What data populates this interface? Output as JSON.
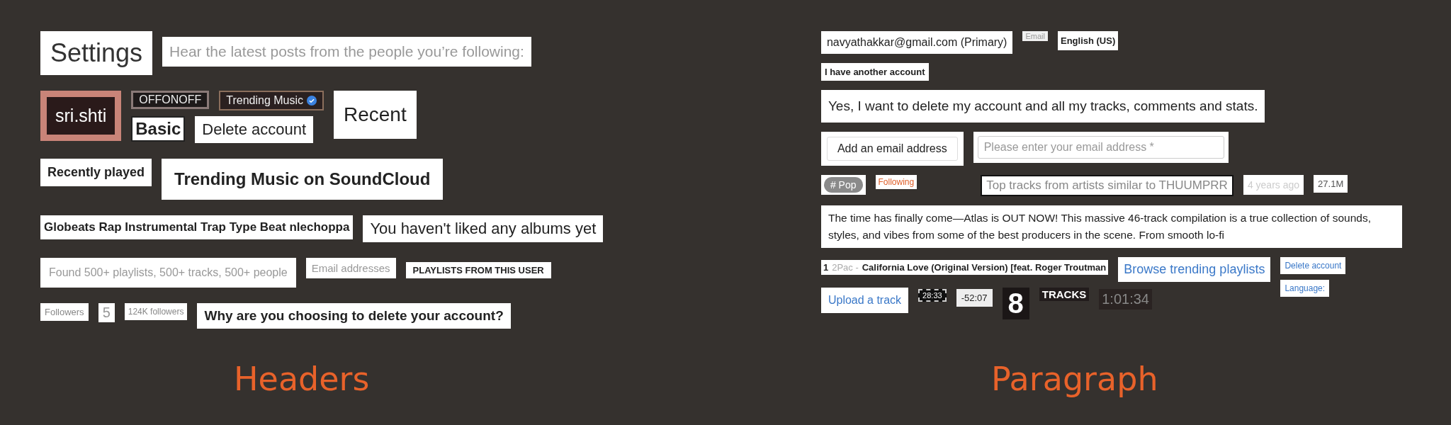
{
  "sections": [
    {
      "title": "Headers",
      "groups": [
        {
          "items": [
            {
              "kind": "title",
              "text": "Settings"
            },
            {
              "kind": "subtitle",
              "text": "Hear the latest posts from the people you’re following:"
            }
          ]
        },
        {
          "items": [
            {
              "kind": "username",
              "text": "sri.shti"
            },
            {
              "kind": "stack",
              "groups": [
                {
                  "items": [
                    {
                      "kind": "toggle-label",
                      "text": "OFFONOFF"
                    },
                    {
                      "kind": "verified",
                      "text": "Trending Music"
                    }
                  ]
                },
                {
                  "items": [
                    {
                      "kind": "basic",
                      "text": "Basic"
                    },
                    {
                      "kind": "heading-md",
                      "text": "Delete account"
                    }
                  ]
                }
              ]
            },
            {
              "kind": "recent",
              "text": "Recent"
            }
          ]
        },
        {
          "items": [
            {
              "kind": "heading-sm",
              "text": "Recently played"
            },
            {
              "kind": "heading-lg",
              "text": "Trending Music on SoundCloud"
            }
          ]
        },
        {
          "items": [
            {
              "kind": "track-title",
              "text": "Globeats Rap Instrumental Trap Type Beat nlechoppa"
            },
            {
              "kind": "empty-state",
              "text": "You haven't liked any albums yet"
            }
          ]
        },
        {
          "items": [
            {
              "kind": "muted",
              "text": "Found 500+ playlists, 500+ tracks, 500+ people"
            },
            {
              "kind": "muted-sm",
              "text": "Email addresses"
            },
            {
              "kind": "caps",
              "text": "PLAYLISTS FROM THIS USER"
            }
          ]
        },
        {
          "items": [
            {
              "kind": "label-xs",
              "text": "Followers"
            },
            {
              "kind": "count",
              "text": "5"
            },
            {
              "kind": "caption",
              "text": "124K followers"
            },
            {
              "kind": "question",
              "text": "Why are you choosing to delete your account?"
            }
          ]
        }
      ]
    },
    {
      "title": "Paragraph",
      "groups": [
        {
          "items": [
            {
              "kind": "email-primary",
              "text": "navyathakkar@gmail.com (Primary)"
            },
            {
              "kind": "tiny-label",
              "text": "Email"
            },
            {
              "kind": "lang",
              "text": "English (US)"
            }
          ]
        },
        {
          "items": [
            {
              "kind": "small-bold",
              "text": "I have another account"
            }
          ]
        },
        {
          "items": [
            {
              "kind": "confirm",
              "text": "Yes, I want to delete my account and all my tracks, comments and stats."
            }
          ]
        },
        {
          "items": [
            {
              "kind": "outlined-button",
              "text": "Add an email address"
            },
            {
              "kind": "input",
              "placeholder": "Please enter your email address *"
            }
          ]
        },
        {
          "items": [
            {
              "kind": "tag",
              "text": "# Pop"
            },
            {
              "kind": "follow-link",
              "text": "Following"
            },
            {
              "kind": "outlined-text",
              "text": "Top tracks from artists similar to THUUMPRR"
            },
            {
              "kind": "timestamp",
              "text": "4 years ago"
            },
            {
              "kind": "stat",
              "text": "27.1M"
            }
          ]
        },
        {
          "items": [
            {
              "kind": "paragraph",
              "text": "The time has finally come—Atlas is OUT NOW! This massive 46-track compilation is a true collection of sounds, styles, and vibes from some of the best producers in the scene. From smooth lo-fi"
            }
          ]
        },
        {
          "items": [
            {
              "kind": "stack",
              "groups": [
                {
                  "items": [
                    {
                      "kind": "track-line",
                      "number": "1",
                      "artist": "2Pac -",
                      "title": "California Love (Original Version) [feat. Roger Troutman"
                    },
                    {
                      "kind": "link-lg",
                      "text": "Browse trending playlists"
                    }
                  ]
                },
                {
                  "items": [
                    {
                      "kind": "link-md",
                      "text": "Upload a track"
                    },
                    {
                      "kind": "duration-chip",
                      "text": "28:33"
                    },
                    {
                      "kind": "remaining",
                      "text": "-52:07"
                    },
                    {
                      "kind": "big-count",
                      "text": "8"
                    },
                    {
                      "kind": "tracks-label",
                      "text": "TRACKS"
                    },
                    {
                      "kind": "total-duration",
                      "text": "1:01:34"
                    }
                  ]
                }
              ]
            },
            {
              "kind": "stack",
              "groups": [
                {
                  "items": [
                    {
                      "kind": "link-sm",
                      "text": "Delete account"
                    }
                  ]
                },
                {
                  "items": [
                    {
                      "kind": "link-sm",
                      "text": "Language:"
                    }
                  ]
                }
              ]
            }
          ]
        }
      ]
    }
  ]
}
